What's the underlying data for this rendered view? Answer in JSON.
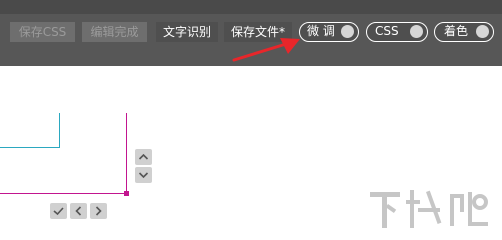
{
  "toolbar": {
    "save_css_label": "保存CSS",
    "edit_done_label": "编辑完成",
    "text_recognition_label": "文字识别",
    "save_file_label": "保存文件*"
  },
  "toggles": {
    "fine_tune_label": "微 调",
    "css_label": "CSS",
    "color_label": "着色"
  },
  "colors": {
    "toolbar_bg": "#575757",
    "guide_cyan": "#2ba8c0",
    "guide_magenta": "#c2158f",
    "arrow_red": "#e8262a"
  },
  "icons": {
    "up": "chevron-up-icon",
    "down": "chevron-down-icon",
    "check": "check-icon",
    "left": "chevron-left-icon",
    "right": "chevron-right-icon"
  },
  "watermark": "下载吧"
}
